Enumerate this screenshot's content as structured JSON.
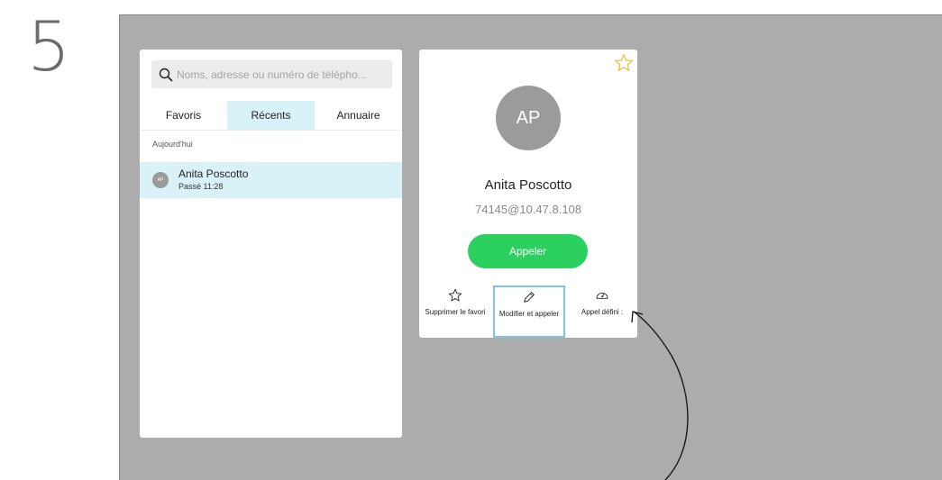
{
  "step": "5",
  "search": {
    "placeholder": "Noms, adresse ou numéro de télépho..."
  },
  "tabs": [
    {
      "label": "Favoris"
    },
    {
      "label": "Récents"
    },
    {
      "label": "Annuaire"
    }
  ],
  "recents": {
    "section_label": "Aujourd'hui",
    "items": [
      {
        "initials": "AP",
        "name": "Anita Poscotto",
        "detail": "Passé 11:28"
      }
    ]
  },
  "contact": {
    "initials": "AP",
    "name": "Anita Poscotto",
    "address": "74145@10.47.8.108",
    "call_label": "Appeler",
    "actions": [
      {
        "label": "Supprimer le favori"
      },
      {
        "label": "Modifier et appeler"
      },
      {
        "label": "Appel défini :"
      }
    ]
  },
  "colors": {
    "accent_green": "#2bd05f",
    "selected_tab": "#d9f2f8",
    "favorite_star": "#f0b42a",
    "highlight_border": "#7ac6e4"
  }
}
